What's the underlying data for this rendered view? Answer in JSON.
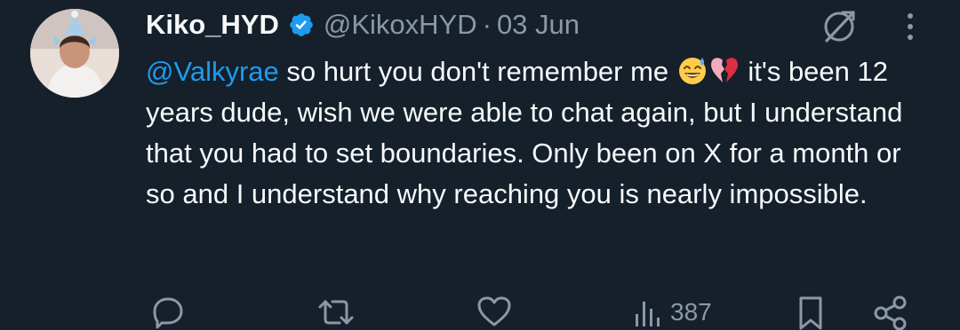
{
  "tweet": {
    "display_name": "Kiko_HYD",
    "handle": "@KikoxHYD",
    "separator": "·",
    "date": "03 Jun",
    "mention": "@Valkyrae",
    "text_part1": " so hurt you don't remember me ",
    "text_part2": " it's been 12 years dude, wish we were able to chat again, but I understand that you had to set boundaries. Only been on X for a month or so and I understand why reaching you is nearly impossible.",
    "emojis": [
      "sweat-smile-emoji",
      "broken-heart-emoji"
    ]
  },
  "actions": {
    "views": "387"
  },
  "icons": {
    "verified": "verified-badge-icon",
    "grok": "grok-icon",
    "more": "more-vertical-icon",
    "reply": "reply-icon",
    "repost": "repost-icon",
    "like": "like-icon",
    "views": "views-icon",
    "bookmark": "bookmark-icon",
    "share": "share-icon"
  },
  "colors": {
    "background": "#15202b",
    "text": "#f7f9f9",
    "muted": "#8b98a5",
    "accent": "#1d9bf0"
  }
}
